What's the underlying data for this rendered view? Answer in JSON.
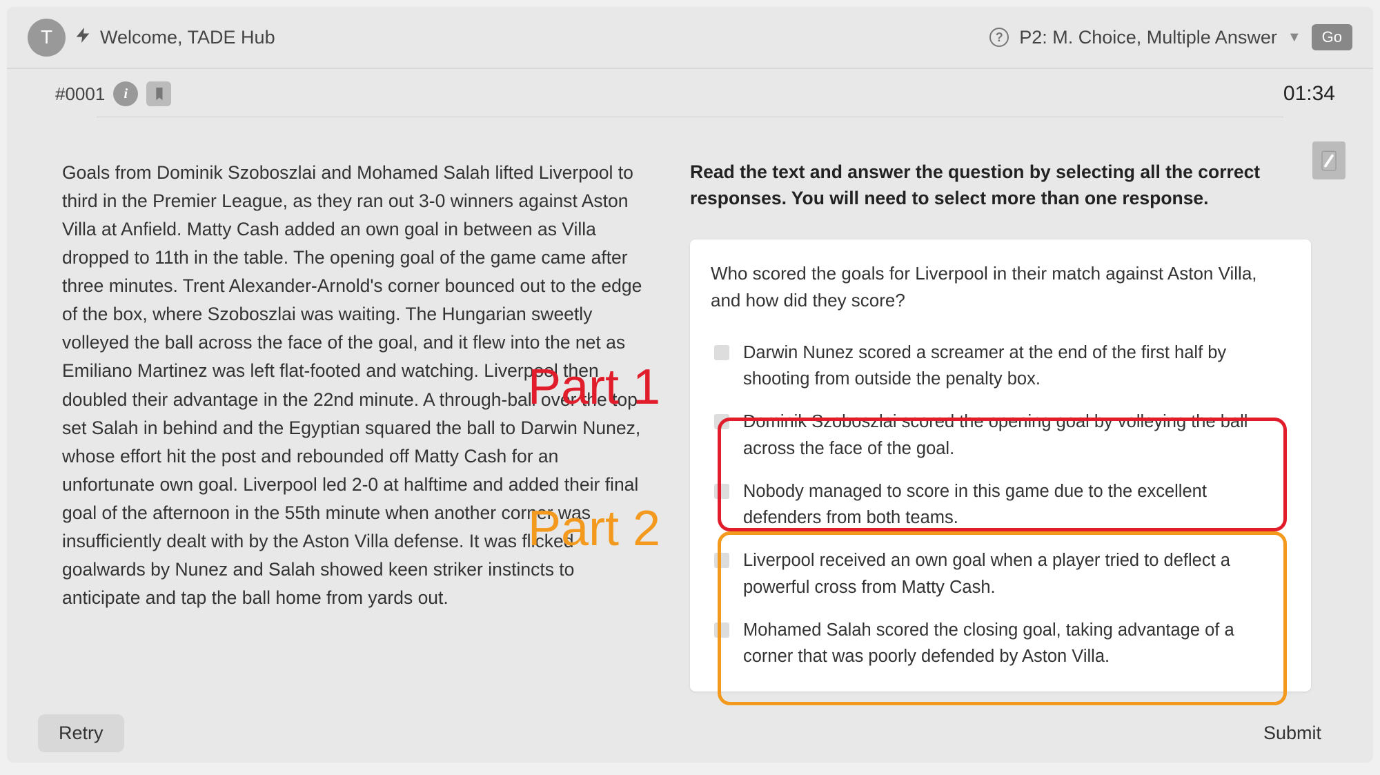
{
  "header": {
    "avatar_letter": "T",
    "welcome_text": "Welcome, TADE Hub",
    "section_label": "P2: M. Choice, Multiple Answer",
    "go_label": "Go"
  },
  "info_bar": {
    "question_id": "#0001",
    "timer": "01:34"
  },
  "passage": "Goals from Dominik Szoboszlai and Mohamed Salah lifted Liverpool to third in the Premier League, as they ran out 3-0 winners against Aston Villa at Anfield. Matty Cash added an own goal in between as Villa dropped to 11th in the table. The opening goal of the game came after three minutes. Trent Alexander-Arnold's corner bounced out to the edge of the box, where Szoboszlai was waiting. The Hungarian sweetly volleyed the ball across the face of the goal, and it flew into the net as Emiliano Martinez was left flat-footed and watching. Liverpool then doubled their advantage in the 22nd minute. A through-ball over the top set Salah in behind and the Egyptian squared the ball to Darwin Nunez, whose effort hit the post and rebounded off Matty Cash for an unfortunate own goal. Liverpool led 2-0 at halftime and added their final goal of the afternoon in the 55th minute when another corner was insufficiently dealt with by the Aston Villa defense. It was flicked goalwards by Nunez and Salah showed keen striker instincts to anticipate and tap the ball home from yards out.",
  "instruction": "Read the text and answer the question by selecting all the correct responses. You will need to select more than one response.",
  "question": "Who scored the goals for Liverpool in their match against Aston Villa, and how did they score?",
  "options": [
    "Darwin Nunez scored a screamer at the end of the first half by shooting from outside the penalty box.",
    "Dominik Szoboszlai scored the opening goal by volleying the ball across the face of the goal.",
    "Nobody managed to score in this game due to the excellent defenders from both teams.",
    "Liverpool received an own goal when a player tried to deflect a powerful cross from Matty Cash.",
    "Mohamed Salah scored the closing goal, taking advantage of a corner that was poorly defended by Aston Villa."
  ],
  "overlays": {
    "part1": "Part 1",
    "part2": "Part 2"
  },
  "footer": {
    "retry_label": "Retry",
    "submit_label": "Submit"
  }
}
